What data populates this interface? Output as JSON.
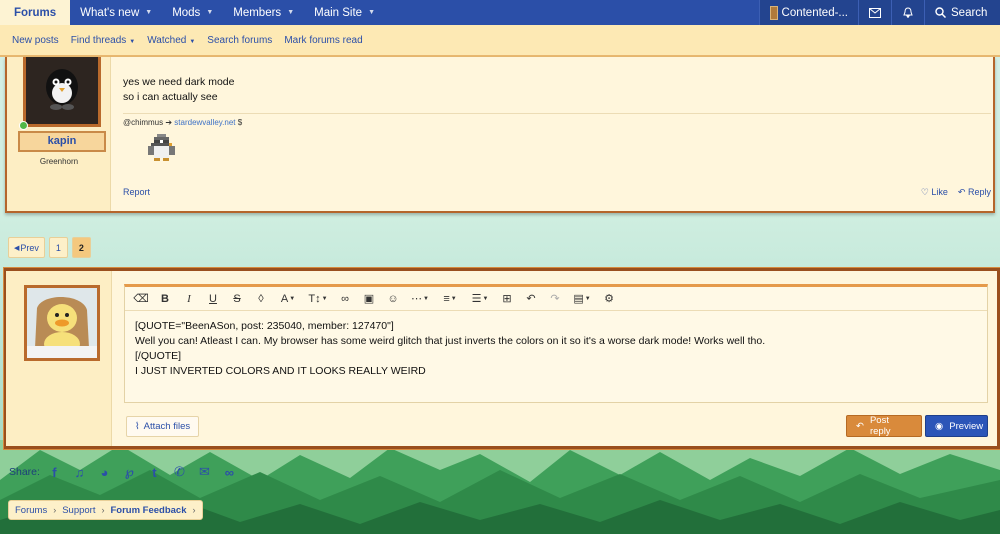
{
  "topnav": {
    "tabs": [
      {
        "label": "Forums",
        "active": true,
        "has_caret": false
      },
      {
        "label": "What's new",
        "has_caret": true
      },
      {
        "label": "Mods",
        "has_caret": true
      },
      {
        "label": "Members",
        "has_caret": true
      },
      {
        "label": "Main Site",
        "has_caret": true
      }
    ],
    "account_label": "Contented-...",
    "search_label": "Search"
  },
  "subnav": {
    "items": [
      "New posts",
      "Find threads",
      "Watched",
      "Search forums",
      "Mark forums read"
    ]
  },
  "message": {
    "username": "kapin",
    "user_title": "Greenhorn",
    "body_lines": [
      "yes we need dark mode",
      "so i can actually see"
    ],
    "signature_handle": "@chimmus",
    "signature_arrow": "➔",
    "signature_link": "stardewvalley.net",
    "signature_suffix": "$",
    "report_label": "Report",
    "like_label": "Like",
    "reply_label": "Reply"
  },
  "pagination": {
    "prev_label": "Prev",
    "pages": [
      "1",
      "2"
    ],
    "current_page": "2"
  },
  "reply_box": {
    "editor_text": "[QUOTE=\"BeenASon, post: 235040, member: 127470\"]\nWell you can! Atleast I can. My browser has some weird glitch that just inverts the colors on it so it's a worse dark mode! Works well tho.\n[/QUOTE]\nI JUST INVERTED COLORS AND IT LOOKS REALLY WEIRD",
    "attach_label": "Attach files",
    "post_label": "Post reply",
    "preview_label": "Preview"
  },
  "share": {
    "label": "Share:",
    "icons": [
      "facebook-icon",
      "twitter-icon",
      "reddit-icon",
      "pinterest-icon",
      "tumblr-icon",
      "whatsapp-icon",
      "email-icon",
      "link-icon"
    ]
  },
  "breadcrumb": {
    "items": [
      "Forums",
      "Support"
    ],
    "current": "Forum Feedback"
  },
  "colors": {
    "nav_blue": "#2b4fa8",
    "cream": "#fff6dc",
    "border_brown": "#b5652b",
    "accent_orange": "#d98a3b"
  }
}
